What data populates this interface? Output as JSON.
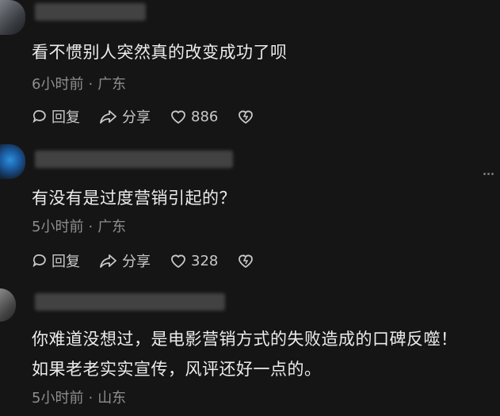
{
  "comments": [
    {
      "text": "看不惯别人突然真的改变成功了呗",
      "time": "6小时前",
      "location": "广东",
      "reply_label": "回复",
      "share_label": "分享",
      "likes": "886"
    },
    {
      "text": "有没有是过度营销引起的？",
      "time": "5小时前",
      "location": "广东",
      "reply_label": "回复",
      "share_label": "分享",
      "likes": "328"
    },
    {
      "text_lines": [
        "你难道没想过，是电影营销方式的失败造成的口碑反噬！",
        "如果老老实实宣传，风评还好一点的。"
      ],
      "time": "5小时前",
      "location": "山东"
    }
  ],
  "separator": "·",
  "icons": [
    "reply-icon",
    "share-icon",
    "heart-icon",
    "dislike-icon",
    "more-icon"
  ],
  "colors": {
    "background": "#151515",
    "text": "#ececec",
    "meta": "#8e8e8e",
    "action": "#c9c9c9"
  }
}
